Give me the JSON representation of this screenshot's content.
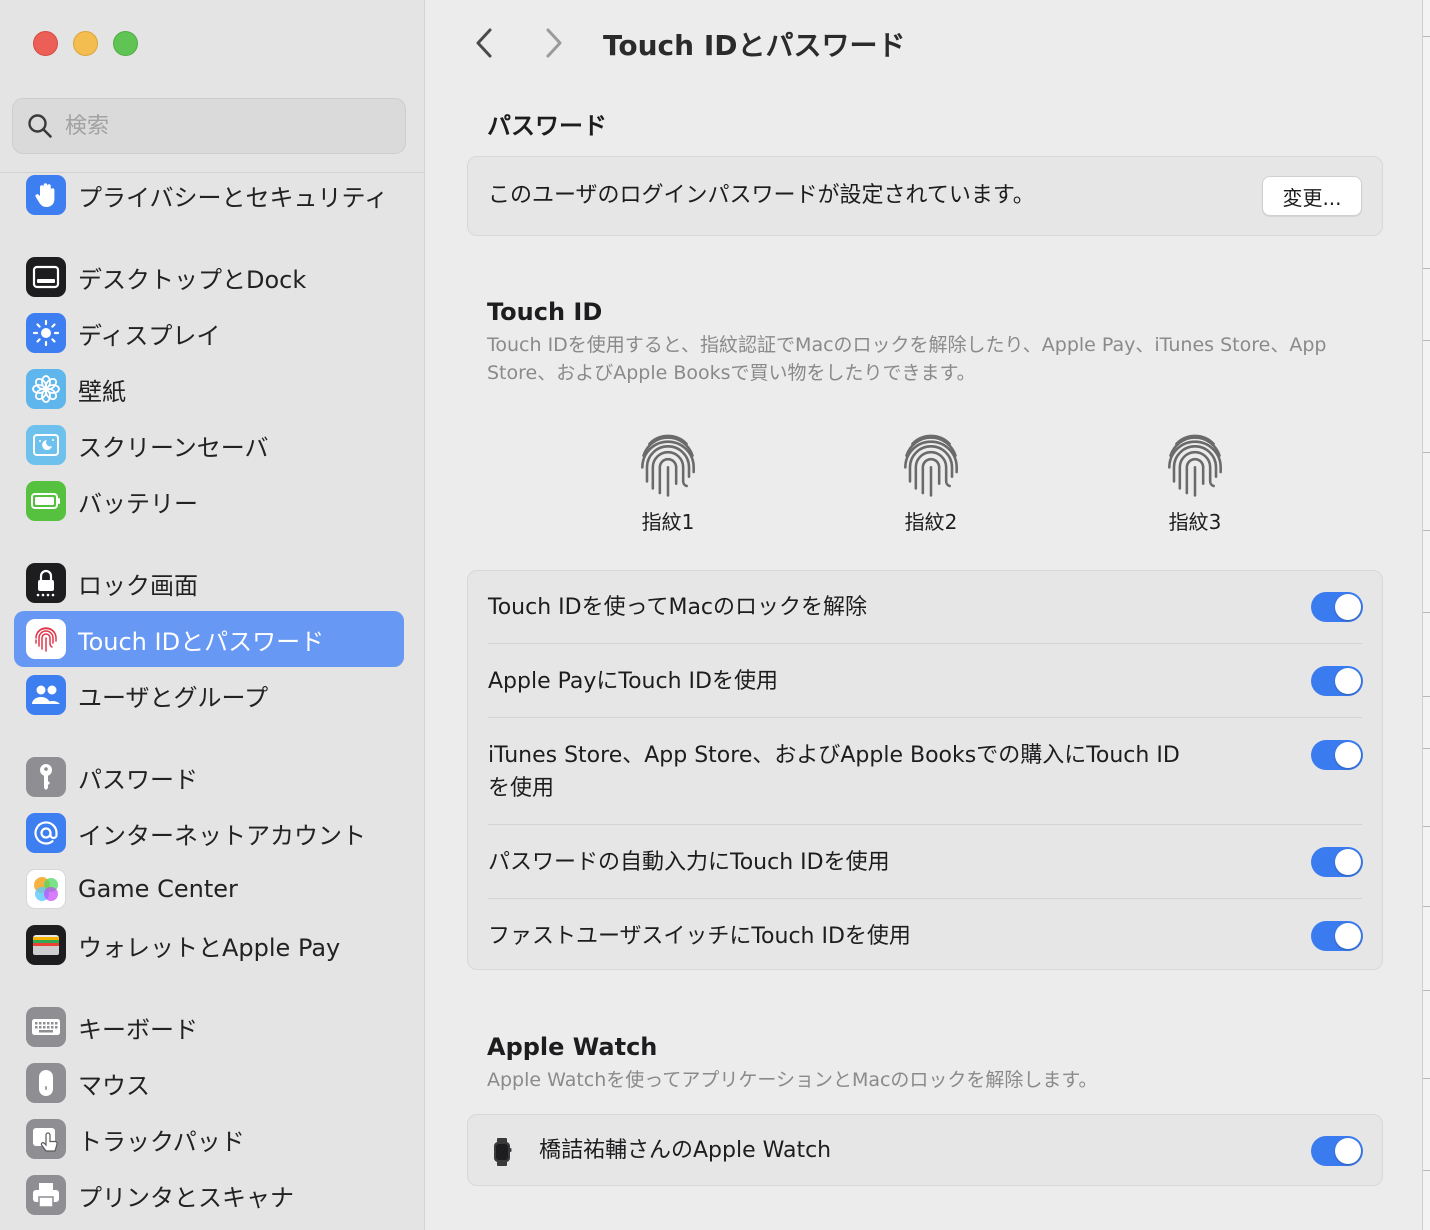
{
  "sidebar": {
    "search_placeholder": "検索",
    "items": [
      {
        "label": "プライバシーとセキュリティ",
        "icon": "hand-icon",
        "color": "#3d7ef0"
      },
      {
        "label": "デスクトップとDock",
        "icon": "dock-icon",
        "color": "#1d1d1f"
      },
      {
        "label": "ディスプレイ",
        "icon": "sun-icon",
        "color": "#3d7ef0"
      },
      {
        "label": "壁紙",
        "icon": "flower-icon",
        "color": "#5fb6ec"
      },
      {
        "label": "スクリーンセーバ",
        "icon": "screensaver-icon",
        "color": "#6ec1ec"
      },
      {
        "label": "バッテリー",
        "icon": "battery-icon",
        "color": "#55c13e"
      },
      {
        "label": "ロック画面",
        "icon": "lock-icon",
        "color": "#1d1d1f"
      },
      {
        "label": "Touch IDとパスワード",
        "icon": "fingerprint-icon",
        "color": "#ffffff",
        "active": true
      },
      {
        "label": "ユーザとグループ",
        "icon": "users-icon",
        "color": "#3d7ef0"
      },
      {
        "label": "パスワード",
        "icon": "key-icon",
        "color": "#8e8e93"
      },
      {
        "label": "インターネットアカウント",
        "icon": "at-icon",
        "color": "#3d7ef0"
      },
      {
        "label": "Game Center",
        "icon": "game-center-icon",
        "color": "#ffffff"
      },
      {
        "label": "ウォレットとApple Pay",
        "icon": "wallet-icon",
        "color": "#1d1d1f"
      },
      {
        "label": "キーボード",
        "icon": "keyboard-icon",
        "color": "#8e8e93"
      },
      {
        "label": "マウス",
        "icon": "mouse-icon",
        "color": "#8e8e93"
      },
      {
        "label": "トラックパッド",
        "icon": "trackpad-icon",
        "color": "#8e8e93"
      },
      {
        "label": "プリンタとスキャナ",
        "icon": "printer-icon",
        "color": "#8e8e93"
      }
    ]
  },
  "header": {
    "title": "Touch IDとパスワード"
  },
  "password": {
    "title": "パスワード",
    "status": "このユーザのログインパスワードが設定されています。",
    "change_label": "変更..."
  },
  "touchid": {
    "title": "Touch ID",
    "description": "Touch IDを使用すると、指紋認証でMacのロックを解除したり、Apple Pay、iTunes Store、App Store、およびApple Booksで買い物をしたりできます。",
    "fingerprints": [
      "指紋1",
      "指紋2",
      "指紋3"
    ],
    "options": [
      {
        "label": "Touch IDを使ってMacのロックを解除",
        "enabled": true
      },
      {
        "label": "Apple PayにTouch IDを使用",
        "enabled": true
      },
      {
        "label": "iTunes Store、App Store、およびApple Booksでの購入にTouch IDを使用",
        "enabled": true
      },
      {
        "label": "パスワードの自動入力にTouch IDを使用",
        "enabled": true
      },
      {
        "label": "ファストユーザスイッチにTouch IDを使用",
        "enabled": true
      }
    ]
  },
  "apple_watch": {
    "title": "Apple Watch",
    "description": "Apple Watchを使ってアプリケーションとMacのロックを解除します。",
    "device": {
      "label": "橋詰祐輔さんのApple Watch",
      "enabled": true
    }
  },
  "colors": {
    "accent": "#3a7cf0",
    "selection": "#6798f4"
  }
}
